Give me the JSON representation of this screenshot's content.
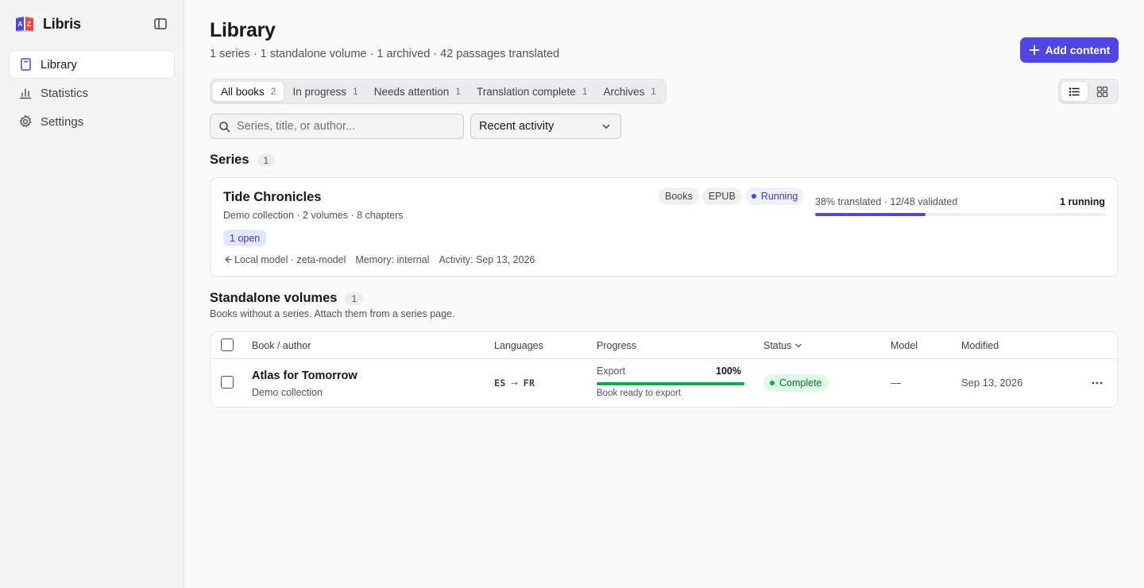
{
  "app": {
    "name": "Libris"
  },
  "sidebar": {
    "items": [
      {
        "label": "Library",
        "icon": "book-icon",
        "active": true
      },
      {
        "label": "Statistics",
        "icon": "bar-chart-icon",
        "active": false
      },
      {
        "label": "Settings",
        "icon": "gear-icon",
        "active": false
      }
    ]
  },
  "header": {
    "title": "Library",
    "subtitle": "1 series · 1 standalone volume · 1 archived · 42 passages translated",
    "add_label": "Add content"
  },
  "tabs": [
    {
      "label": "All books",
      "count": "2",
      "active": true
    },
    {
      "label": "In progress",
      "count": "1",
      "active": false
    },
    {
      "label": "Needs attention",
      "count": "1",
      "active": false
    },
    {
      "label": "Translation complete",
      "count": "1",
      "active": false
    },
    {
      "label": "Archives",
      "count": "1",
      "active": false
    }
  ],
  "view_mode": "list",
  "search": {
    "placeholder": "Series, title, or author...",
    "value": ""
  },
  "sort": {
    "selected": "Recent activity"
  },
  "series_section": {
    "title": "Series",
    "count": "1",
    "card": {
      "title": "Tide Chronicles",
      "meta": "Demo collection · 2 volumes · 8 chapters",
      "open_badge": "1 open",
      "tags": [
        "Books",
        "EPUB"
      ],
      "status": "Running",
      "progress_label": "38% translated · 12/48 validated",
      "progress": 0.38,
      "running": "1 running",
      "model": "Local model · zeta-model",
      "memory": "Memory: internal",
      "activity": "Activity: Sep 13, 2026"
    }
  },
  "standalone_section": {
    "title": "Standalone volumes",
    "count": "1",
    "description": "Books without a series. Attach them from a series page.",
    "columns": {
      "book": "Book / author",
      "languages": "Languages",
      "progress": "Progress",
      "status": "Status",
      "model": "Model",
      "modified": "Modified"
    },
    "rows": [
      {
        "title": "Atlas for Tomorrow",
        "author": "Demo collection",
        "source_lang": "ES",
        "target_lang": "FR",
        "progress_label": "Export",
        "progress_pct": "100%",
        "progress": 1.0,
        "progress_note": "Book ready to export",
        "status": "Complete",
        "model": "—",
        "modified": "Sep 13, 2026"
      }
    ]
  },
  "colors": {
    "accent": "#4f46e5",
    "success": "#16a34a",
    "sidebar_bg": "#f4f4f5"
  }
}
